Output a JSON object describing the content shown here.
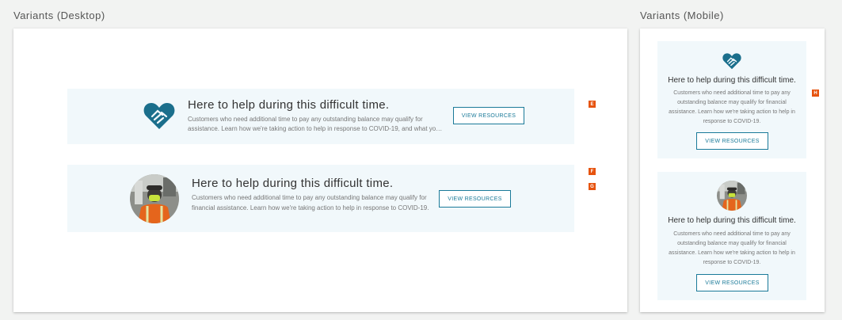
{
  "sections": {
    "desktop_title": "Variants (Desktop)",
    "mobile_title": "Variants (Mobile)"
  },
  "banner": {
    "title": "Here to help during this difficult time.",
    "body_truncated": "Customers who need additional time to pay any outstanding balance may qualify for financial assistance. Learn how we're taking action to help in response to COVID-19, and what you can do.",
    "body": "Customers who need additional time to pay any outstanding balance may qualify for financial assistance. Learn how we're taking action to help in response to COVID-19.",
    "button_label": "VIEW RESOURCES"
  },
  "markers": {
    "e": "E",
    "f": "F",
    "g": "G",
    "h": "H"
  },
  "colors": {
    "accent": "#1a7a99",
    "icon": "#1b6f8c",
    "banner_bg": "#f1f8fb",
    "marker": "#e6530f"
  },
  "icons": {
    "heart": "heart-handshake-icon",
    "photo": "worker-photo"
  }
}
